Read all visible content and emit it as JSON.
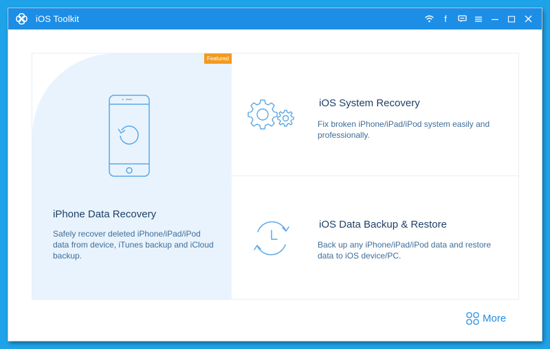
{
  "app": {
    "title": "iOS Toolkit",
    "icon": "toolkit-logo-icon"
  },
  "titlebar": {
    "controls": [
      "wifi-icon",
      "facebook-icon",
      "feedback-icon",
      "menu-icon",
      "minimize-icon",
      "maximize-icon",
      "close-icon"
    ],
    "facebook_glyph": "f"
  },
  "featured_card": {
    "badge": "Featured",
    "title": "iPhone Data Recovery",
    "description": "Safely recover deleted iPhone/iPad/iPod data from device, iTunes backup and iCloud backup.",
    "icon": "phone-restore-icon"
  },
  "cards": [
    {
      "title": "iOS System Recovery",
      "description": "Fix broken iPhone/iPad/iPod system easily and professionally.",
      "icon": "gears-icon"
    },
    {
      "title": "iOS Data Backup & Restore",
      "description": "Back up any iPhone/iPad/iPod data and restore data to iOS device/PC.",
      "icon": "clock-sync-icon"
    }
  ],
  "more": {
    "label": "More",
    "icon": "grid-more-icon"
  },
  "colors": {
    "accent": "#1d8ee6",
    "featured_bg": "#e9f3fd",
    "badge": "#f39a1c",
    "title_text": "#1d3f66",
    "desc_text": "#3d6d99",
    "icon_stroke": "#5aa7e6"
  }
}
